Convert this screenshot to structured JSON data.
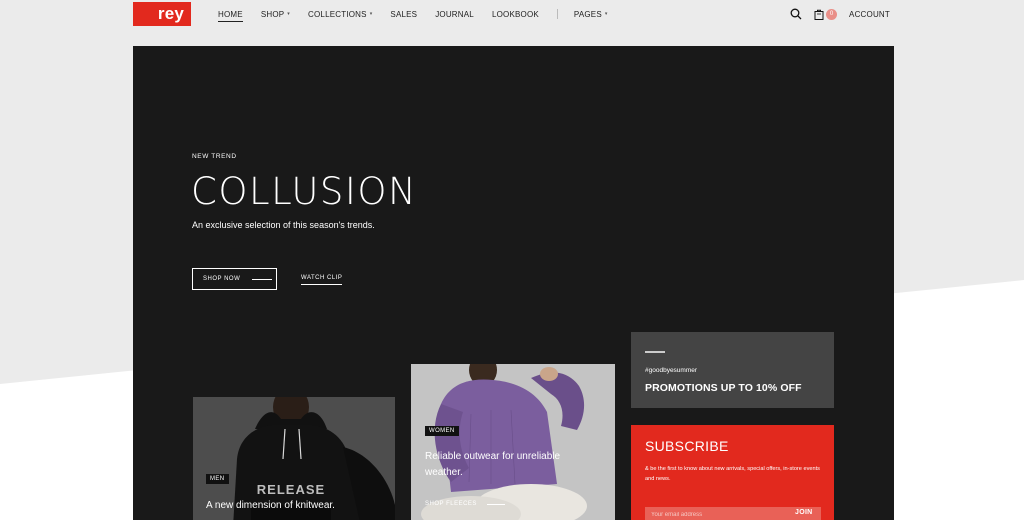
{
  "brand": {
    "logo_text": "rey",
    "accent": "#e2291e"
  },
  "nav": {
    "items": [
      {
        "label": "HOME",
        "active": true,
        "has_dropdown": false
      },
      {
        "label": "SHOP",
        "active": false,
        "has_dropdown": true
      },
      {
        "label": "COLLECTIONS",
        "active": false,
        "has_dropdown": true
      },
      {
        "label": "SALES",
        "active": false,
        "has_dropdown": false
      },
      {
        "label": "JOURNAL",
        "active": false,
        "has_dropdown": false
      },
      {
        "label": "LOOKBOOK",
        "active": false,
        "has_dropdown": false
      },
      {
        "label": "PAGES",
        "active": false,
        "has_dropdown": true
      }
    ],
    "caret": "▾"
  },
  "header_right": {
    "search_icon": "search-icon",
    "cart_icon": "shopping-bag-icon",
    "cart_count": "0",
    "account_label": "ACCOUNT"
  },
  "hero": {
    "kicker": "NEW TREND",
    "title": "COLLUSION",
    "subtitle": "An exclusive selection of this season's trends.",
    "primary_button": "SHOP NOW",
    "secondary_link": "WATCH CLIP",
    "background": "#191919"
  },
  "cards": {
    "men": {
      "tag": "MEN",
      "text": "A new dimension of knitwear.",
      "print_text": "RELEASE"
    },
    "women": {
      "tag": "WOMEN",
      "text_line1": "Reliable outwear for unreliable",
      "text_line2": "weather.",
      "link": "SHOP FLEECES"
    }
  },
  "promo": {
    "hashtag": "#goodbyesummer",
    "title": "PROMOTIONS UP TO 10% OFF",
    "background": "#444444"
  },
  "subscribe": {
    "title": "SUBSCRIBE",
    "text": "& be the first to know about new arrivals, special offers, in-store events and news.",
    "input_placeholder": "Your email address",
    "join_label": "JOIN",
    "background": "#e2291e"
  }
}
